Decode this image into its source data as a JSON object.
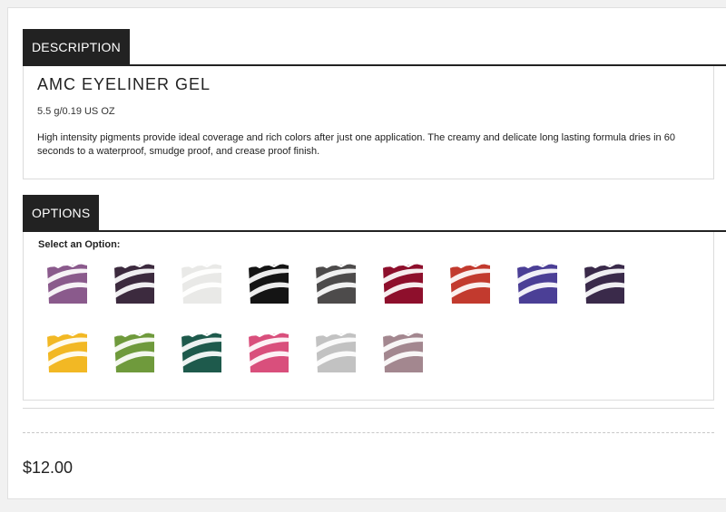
{
  "description": {
    "tab_label": "DESCRIPTION",
    "product_name": "AMC EYELINER GEL",
    "size": "5.5 g/0.19 US OZ",
    "text": "High intensity pigments provide ideal coverage and rich colors after just one application. The creamy and delicate long lasting formula dries in 60 seconds to a waterproof, smudge proof, and crease proof finish."
  },
  "options": {
    "tab_label": "OPTIONS",
    "select_label": "Select an Option:",
    "swatches": [
      {
        "color": "#8a5a8c"
      },
      {
        "color": "#3c2a3e"
      },
      {
        "color": "#e9e9e7"
      },
      {
        "color": "#141414"
      },
      {
        "color": "#4d4b4b"
      },
      {
        "color": "#8e0f2c"
      },
      {
        "color": "#c23a2e"
      },
      {
        "color": "#4b3f96"
      },
      {
        "color": "#3a2a4a"
      },
      {
        "color": "#f2b824"
      },
      {
        "color": "#6f9a3c"
      },
      {
        "color": "#1e5a4c"
      },
      {
        "color": "#d94f7c"
      },
      {
        "color": "#c2c2c2"
      },
      {
        "color": "#a3878f"
      }
    ]
  },
  "price": "$12.00"
}
